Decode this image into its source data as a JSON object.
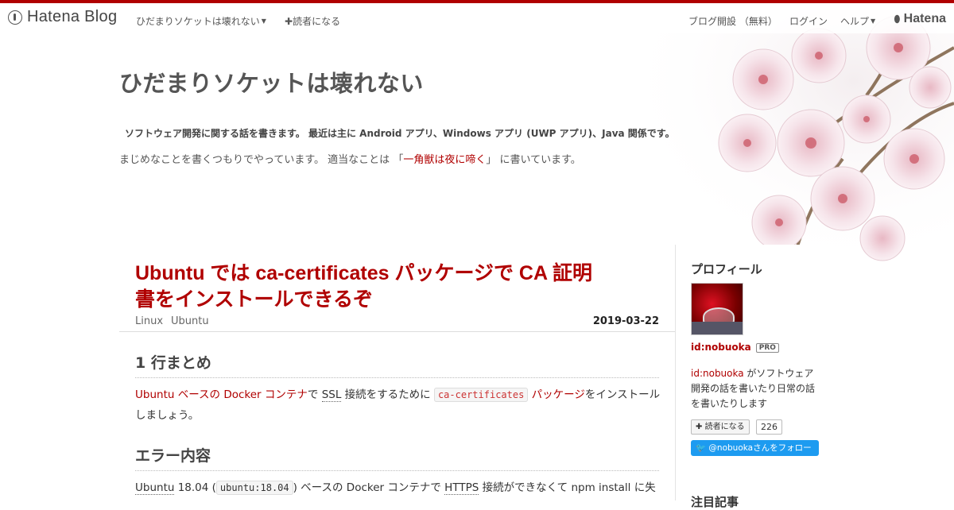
{
  "topbar": {
    "logo_text": "Hatena Blog",
    "blog_menu": "ひだまりソケットは壊れない",
    "subscribe": "読者になる",
    "open_blog": "ブログ開設 （無料）",
    "login": "ログイン",
    "help": "ヘルプ",
    "hatena": "Hatena"
  },
  "header": {
    "title": "ひだまりソケットは壊れない",
    "description_line1": "ソフトウェア開発に関する話を書きます。 最近は主に Android アプリ、Windows アプリ (UWP アプリ)、Java 関係です。",
    "description_line2_prefix": "まじめなことを書くつもりでやっています。 適当なことは 「",
    "description_link": "一角獣は夜に啼く",
    "description_line2_suffix": "」 に書いています。"
  },
  "entry": {
    "title": "Ubuntu では ca-certificates パッケージで CA 証明書をインストールできるぞ",
    "categories": [
      "Linux",
      "Ubuntu"
    ],
    "date": "2019-03-22",
    "section1_heading": "1 行まとめ",
    "summary_link1": "Ubuntu ベースの Docker コンテナ",
    "summary_text1": "で ",
    "summary_ssl": "SSL",
    "summary_text2": " 接続をするために ",
    "summary_code": "ca-certificates",
    "summary_link2": "パッケージ",
    "summary_text3": "をインストールしましょう。",
    "section2_heading": "エラー内容",
    "error_ubuntu": "Ubuntu",
    "error_text1": " 18.04 (",
    "error_code": "ubuntu:18.04",
    "error_text2": ") ベースの Docker コンテナで ",
    "error_https": "HTTPS",
    "error_text3": " 接続ができなくて npm install に失"
  },
  "sidebar": {
    "profile_heading": "プロフィール",
    "user_id": "id:nobuoka",
    "pro_badge": "PRO",
    "bio_link": "id:nobuoka",
    "bio_text": " がソフトウェア開発の話を書いたり日常の話を書いたりします",
    "reader_button": "読者になる",
    "reader_count": "226",
    "twitter_button": "@nobuokaさんをフォロー",
    "next_heading": "注目記事"
  }
}
